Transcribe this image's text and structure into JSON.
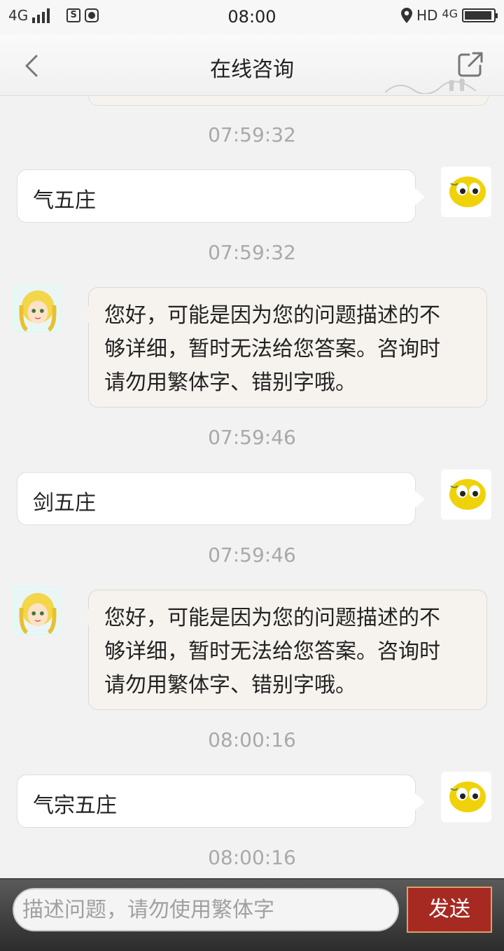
{
  "status_bar": {
    "network_left": "4G",
    "sim_icon_letter": "S",
    "time": "08:00",
    "network_right": "HD",
    "network_right_gen": "4G"
  },
  "header": {
    "title": "在线咨询",
    "back_icon": "chevron-left-icon",
    "share_icon": "share-external-icon"
  },
  "messages": [
    {
      "time": "07:59:32"
    },
    {
      "sender": "user",
      "text": "气五庄"
    },
    {
      "time": "07:59:32"
    },
    {
      "sender": "bot",
      "lines": [
        "您好，可能是因为您的问题描述的不",
        "够详细，暂时无法给您答案。咨询时",
        "请勿用繁体字、错别字哦。"
      ]
    },
    {
      "time": "07:59:46"
    },
    {
      "sender": "user",
      "text": "剑五庄"
    },
    {
      "time": "07:59:46"
    },
    {
      "sender": "bot",
      "lines": [
        "您好，可能是因为您的问题描述的不",
        "够详细，暂时无法给您答案。咨询时",
        "请勿用繁体字、错别字哦。"
      ]
    },
    {
      "time": "08:00:16"
    },
    {
      "sender": "user",
      "text": "气宗五庄"
    },
    {
      "time": "08:00:16"
    }
  ],
  "composer": {
    "placeholder": "描述问题，请勿使用繁体字",
    "send_label": "发送"
  },
  "colors": {
    "send_button": "#a62a22",
    "bot_bubble": "#f6f3ef",
    "user_bubble": "#ffffff",
    "timestamp": "#a9a9a9"
  }
}
